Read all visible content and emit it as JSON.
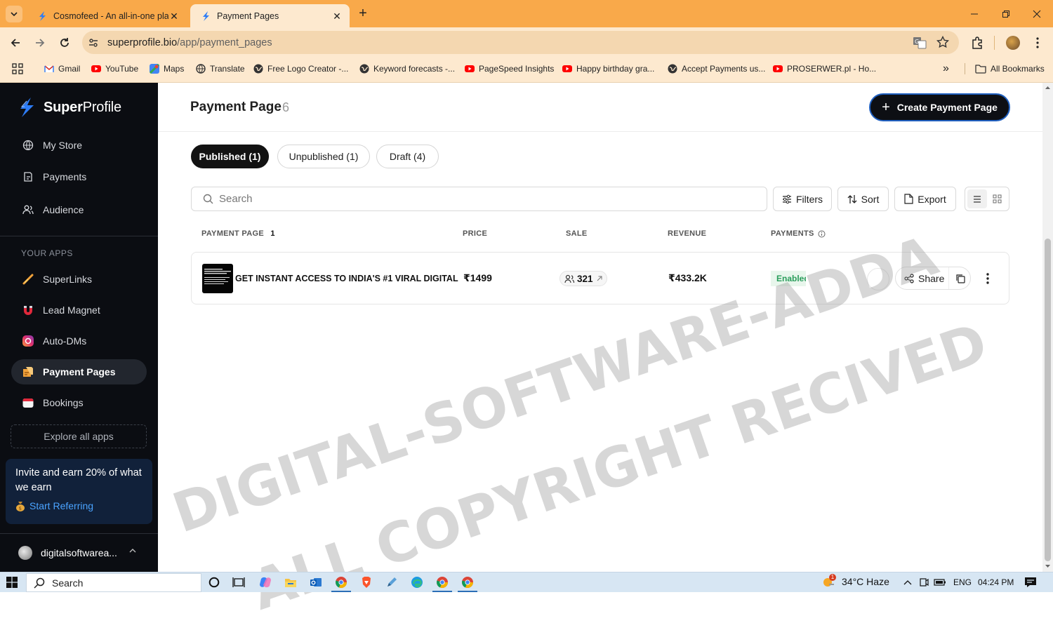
{
  "browser": {
    "tabs": [
      {
        "title": "Cosmofeed - An all-in-one platf",
        "active": false
      },
      {
        "title": "Payment Pages",
        "active": true
      }
    ],
    "new_tab": "+",
    "url_host": "superprofile.bio",
    "url_path": "/app/payment_pages",
    "bookmarks": [
      {
        "label": "Gmail",
        "icon": "gmail-icon"
      },
      {
        "label": "YouTube",
        "icon": "youtube-icon"
      },
      {
        "label": "Maps",
        "icon": "maps-icon"
      },
      {
        "label": "Translate",
        "icon": "translate-icon"
      },
      {
        "label": "Free Logo Creator -...",
        "icon": "globe-icon"
      },
      {
        "label": "Keyword forecasts -...",
        "icon": "globe-icon"
      },
      {
        "label": "PageSpeed Insights",
        "icon": "youtube-icon"
      },
      {
        "label": "Happy birthday gra...",
        "icon": "youtube-icon"
      },
      {
        "label": "Accept Payments us...",
        "icon": "globe-icon"
      },
      {
        "label": "PROSERWER.pl - Ho...",
        "icon": "youtube-icon"
      }
    ],
    "all_bookmarks": "All Bookmarks",
    "overflow": "»"
  },
  "sidebar": {
    "brand_bold": "Super",
    "brand_rest": "Profile",
    "nav": [
      {
        "label": "My Store",
        "icon": "globe-icon"
      },
      {
        "label": "Payments",
        "icon": "receipt-icon"
      },
      {
        "label": "Audience",
        "icon": "users-icon"
      }
    ],
    "section_label": "YOUR APPS",
    "apps": [
      {
        "label": "SuperLinks",
        "icon": "link-icon"
      },
      {
        "label": "Lead Magnet",
        "icon": "magnet-icon"
      },
      {
        "label": "Auto-DMs",
        "icon": "instagram-icon"
      },
      {
        "label": "Payment Pages",
        "icon": "payment-pages-icon",
        "active": true
      },
      {
        "label": "Bookings",
        "icon": "calendar-icon"
      }
    ],
    "explore": "Explore all apps",
    "invite_text": "Invite and earn 20% of what we earn",
    "invite_link": "Start Referring",
    "username": "digitalsoftwarea..."
  },
  "main": {
    "title": "Payment Page",
    "count": "6",
    "create_button": "Create Payment Page",
    "filter_tabs": [
      {
        "label": "Published (1)",
        "active": true
      },
      {
        "label": "Unpublished (1)",
        "active": false
      },
      {
        "label": "Draft (4)",
        "active": false
      }
    ],
    "search_placeholder": "Search",
    "filters_label": "Filters",
    "sort_label": "Sort",
    "export_label": "Export",
    "columns": {
      "payment_page": "PAYMENT PAGE",
      "payment_page_sort": "1",
      "price": "PRICE",
      "sale": "SALE",
      "revenue": "REVENUE",
      "payments": "PAYMENTS"
    },
    "rows": [
      {
        "title": "GET INSTANT ACCESS TO INDIA'S #1 VIRAL DIGITAL",
        "price": "₹1499",
        "sale": "321",
        "revenue": "₹433.2K",
        "status": "Enabled",
        "share_label": "Share"
      }
    ]
  },
  "watermark": {
    "line1": "DIGITAL-SOFTWARE-ADDA",
    "line2": "ALL COPYRIGHT RECIVED"
  },
  "taskbar": {
    "search": "Search",
    "weather": "34°C  Haze",
    "notification_count": "1",
    "language": "ENG",
    "time": "04:24 PM"
  },
  "colors": {
    "tab_bar": "#f9a94a",
    "toolbar": "#fde9cf",
    "sidebar_bg": "#0b0d12",
    "accent_blue": "#1f5fbf",
    "enabled_green": "#2a9d5b"
  }
}
